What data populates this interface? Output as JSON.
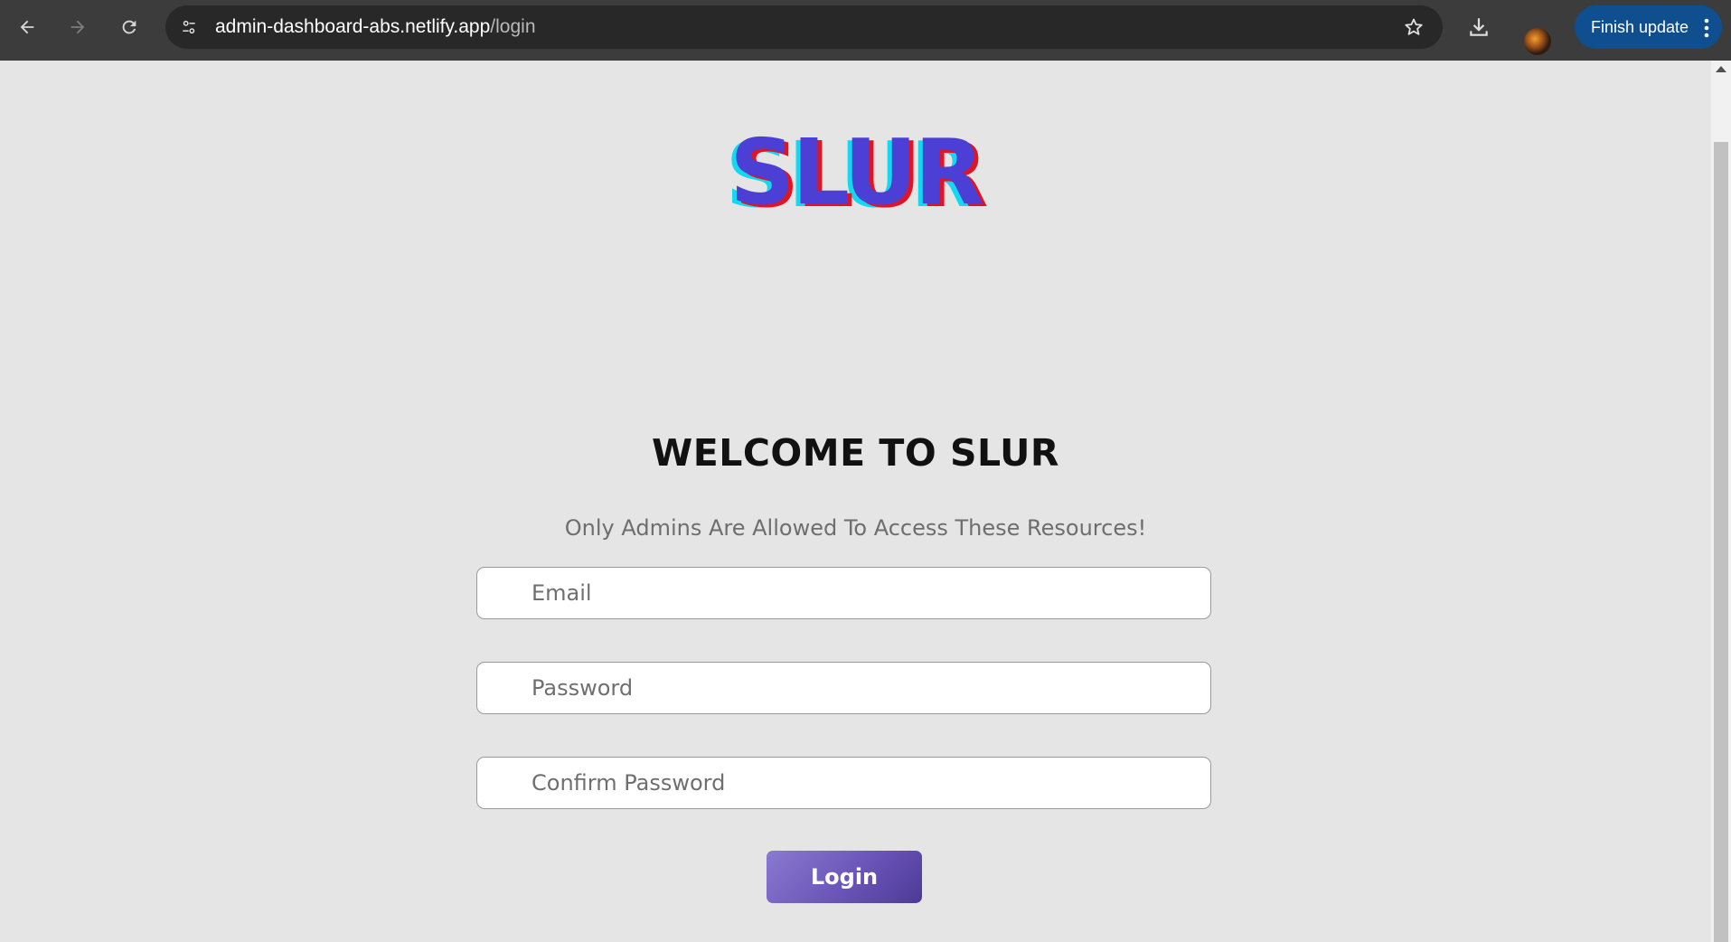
{
  "browser": {
    "url_host": "admin-dashboard-abs.netlify.app",
    "url_path": "/login",
    "finish_update_label": "Finish update",
    "icons": {
      "back": "arrow-left-icon",
      "forward": "arrow-right-icon",
      "reload": "reload-icon",
      "site_info": "tune-icon",
      "bookmark": "star-icon",
      "download": "download-icon",
      "menu": "more-vertical-icon"
    }
  },
  "page": {
    "logo_text": "SLUR",
    "welcome_heading": "WELCOME TO SLUR",
    "subtitle": "Only Admins Are Allowed To Access These Resources!",
    "form": {
      "email_placeholder": "Email",
      "password_placeholder": "Password",
      "confirm_password_placeholder": "Confirm Password",
      "login_label": "Login"
    }
  },
  "colors": {
    "browser_bar": "#3c3c3c",
    "omnibox": "#282828",
    "finish_update_bg": "#0f4f8f",
    "page_bg": "#e5e5e5",
    "logo_main": "#4b3fd6",
    "logo_shadow_red": "#e01423",
    "logo_shadow_cyan": "#12d8f0",
    "login_button_start": "#8a7ad0",
    "login_button_end": "#4d3a96"
  }
}
